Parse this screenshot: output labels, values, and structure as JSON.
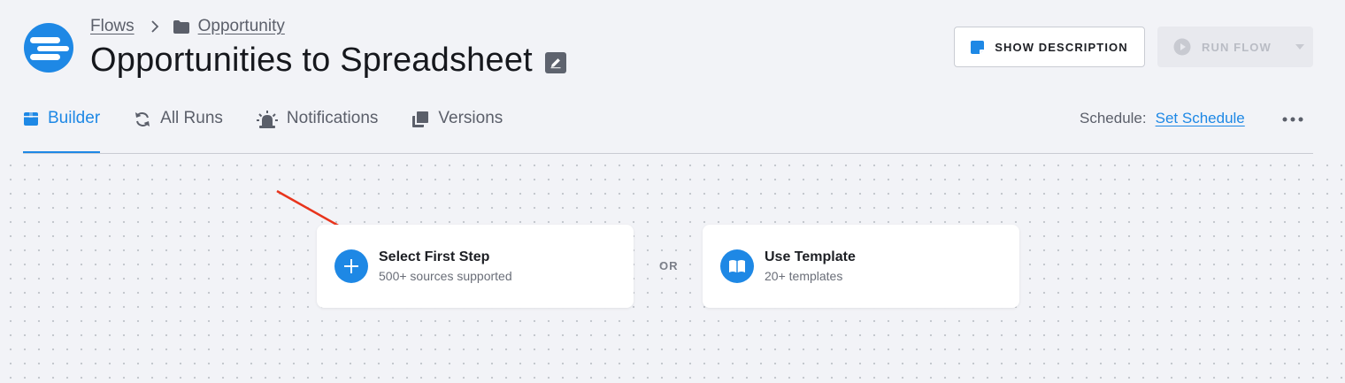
{
  "colors": {
    "accent": "#1e88e5",
    "annotation_arrow": "#e8341c",
    "disabled": "#b9bcc4"
  },
  "breadcrumb": {
    "root": "Flows",
    "folder": "Opportunity",
    "folder_icon": "folder-icon",
    "separator_icon": "chevron-right-icon"
  },
  "header": {
    "title": "Opportunities to Spreadsheet",
    "edit_icon": "pencil-icon",
    "show_description_label": "SHOW DESCRIPTION",
    "run_flow_label": "RUN FLOW",
    "run_flow_enabled": false
  },
  "tabs": [
    {
      "label": "Builder",
      "icon": "package-icon",
      "active": true
    },
    {
      "label": "All Runs",
      "icon": "refresh-icon",
      "active": false
    },
    {
      "label": "Notifications",
      "icon": "alarm-bell-icon",
      "active": false
    },
    {
      "label": "Versions",
      "icon": "stacked-copies-icon",
      "active": false
    }
  ],
  "schedule": {
    "label": "Schedule:",
    "link": "Set Schedule"
  },
  "canvas": {
    "first_step": {
      "title": "Select First Step",
      "subtitle": "500+ sources supported",
      "icon": "plus-icon"
    },
    "separator": "OR",
    "template": {
      "title": "Use Template",
      "subtitle": "20+ templates",
      "icon": "open-book-icon"
    }
  }
}
